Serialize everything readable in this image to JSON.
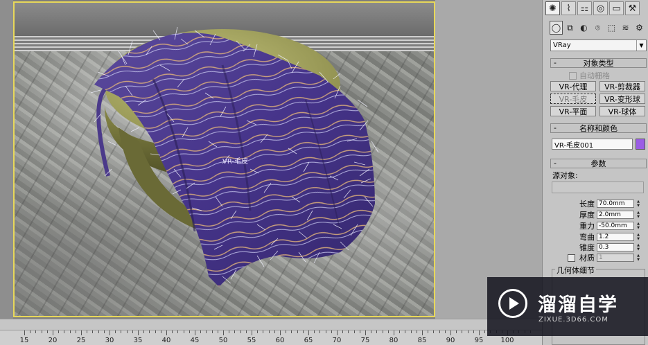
{
  "viewport": {
    "object_label": "VR-毛皮"
  },
  "panel": {
    "tab_icons": [
      "sun-icon",
      "curve-icon",
      "hierarchy-icon",
      "motion-icon",
      "display-icon",
      "wrench-icon"
    ],
    "tab_glyphs": [
      "✺",
      "⌇",
      "⚏",
      "◎",
      "▭",
      "⚒"
    ],
    "subtab_glyphs": [
      "◯",
      "⧉",
      "◐",
      "⌾",
      "⬚",
      "≋",
      "⚙"
    ],
    "renderer_select": "VRay",
    "object_type": {
      "title": "对象类型",
      "auto_grid": "自动栅格",
      "buttons": [
        "VR-代理",
        "VR-剪裁器",
        "VR-毛皮",
        "VR-变形球",
        "VR-平面",
        "VR-球体"
      ]
    },
    "name_color": {
      "title": "名称和颜色",
      "name_value": "VR-毛皮001",
      "color": "#9b5de5"
    },
    "params": {
      "title": "参数",
      "source_label": "源对象:",
      "rows": [
        {
          "label": "长度",
          "value": "70.0mm"
        },
        {
          "label": "厚度",
          "value": "2.0mm"
        },
        {
          "label": "重力",
          "value": "-50.0mm"
        },
        {
          "label": "弯曲",
          "value": "1.2"
        },
        {
          "label": "锥度",
          "value": "0.3"
        }
      ],
      "material_label": "材质",
      "material_value": "1"
    },
    "geometry": {
      "title": "几何体细节"
    },
    "pm_minus": "-"
  },
  "ruler": {
    "labels": [
      "15",
      "20",
      "25",
      "30",
      "35",
      "40",
      "45",
      "50",
      "55",
      "60",
      "65",
      "70",
      "75",
      "80",
      "85",
      "90",
      "95",
      "100"
    ]
  },
  "watermark": {
    "title": "溜溜自学",
    "url": "ZIXUE.3D66.COM"
  }
}
